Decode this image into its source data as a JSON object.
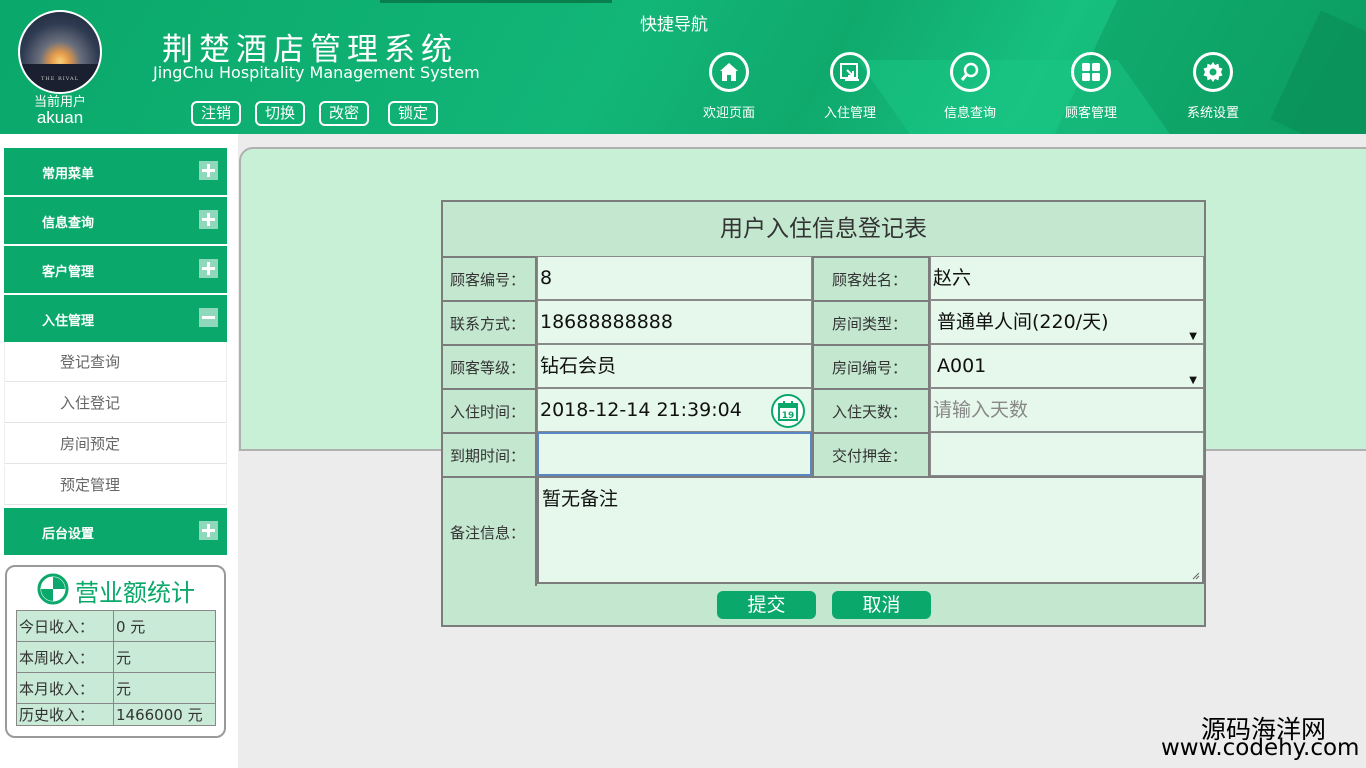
{
  "header": {
    "user_label": "当前用户",
    "username": "akuan",
    "avatar_caption": "THE RIVAL",
    "system_title": "荆楚酒店管理系统",
    "system_subtitle": "JingChu Hospitality Management System",
    "buttons": [
      "注销",
      "切换",
      "改密",
      "锁定"
    ],
    "quick_nav_title": "快捷导航",
    "nav": [
      {
        "label": "欢迎页面",
        "icon": "home-icon"
      },
      {
        "label": "入住管理",
        "icon": "checkin-icon"
      },
      {
        "label": "信息查询",
        "icon": "search-icon"
      },
      {
        "label": "顾客管理",
        "icon": "grid-icon"
      },
      {
        "label": "系统设置",
        "icon": "gear-icon"
      }
    ]
  },
  "sidebar": {
    "menus": [
      {
        "label": "常用菜单",
        "state": "collapsed"
      },
      {
        "label": "信息查询",
        "state": "collapsed"
      },
      {
        "label": "客户管理",
        "state": "collapsed"
      },
      {
        "label": "入住管理",
        "state": "expanded"
      },
      {
        "label": "后台设置",
        "state": "collapsed"
      }
    ],
    "sub_items": [
      "登记查询",
      "入住登记",
      "房间预定",
      "预定管理"
    ]
  },
  "stats": {
    "title": "营业额统计",
    "rows": [
      {
        "label": "今日收入：",
        "value": "0 元"
      },
      {
        "label": "本周收入：",
        "value": "元"
      },
      {
        "label": "本月收入：",
        "value": "元"
      },
      {
        "label": "历史收入：",
        "value": "1466000 元"
      }
    ]
  },
  "form": {
    "title": "用户入住信息登记表",
    "customer_id_label": "顾客编号：",
    "customer_id": "8",
    "customer_name_label": "顾客姓名：",
    "customer_name": "赵六",
    "phone_label": "联系方式：",
    "phone": "18688888888",
    "room_type_label": "房间类型：",
    "room_type": "普通单人间(220/天)",
    "level_label": "顾客等级：",
    "level": "钻石会员",
    "room_no_label": "房间编号：",
    "room_no": "A001",
    "checkin_time_label": "入住时间：",
    "checkin_time": "2018-12-14 21:39:04",
    "calendar_day": "19",
    "days_label": "入住天数：",
    "days_placeholder": "请输入天数",
    "expire_label": "到期时间：",
    "expire": "",
    "deposit_label": "交付押金：",
    "deposit": "",
    "remark_label": "备注信息：",
    "remark": "暂无备注",
    "submit_label": "提交",
    "cancel_label": "取消"
  },
  "watermark": {
    "line1": "源码海洋网",
    "line2": "www.codehy.com"
  },
  "colors": {
    "brand_green": "#0aa86a",
    "panel_mint": "#c8f0d6",
    "form_bg": "#c4e7d0",
    "input_bg": "#e6f7ec"
  }
}
